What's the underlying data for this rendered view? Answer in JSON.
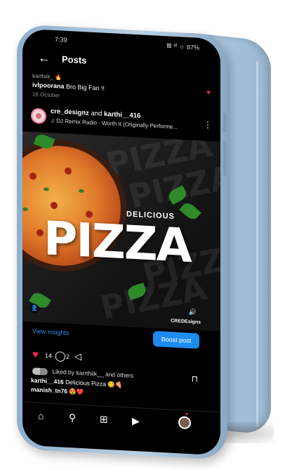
{
  "status": {
    "time": "7:39",
    "signal": "⊠ ᵃᵗ",
    "battery": "87%"
  },
  "header": {
    "title": "Posts"
  },
  "comment": {
    "prev_user": "karthiik_",
    "user": "ivlpoorana",
    "text": "Bro Big Fan !!",
    "date": "18 October"
  },
  "post": {
    "author1": "cre_designz",
    "connector": "and",
    "author2": "karthi__416",
    "music": "DJ Remix Radio · Worth It (Originally Performe...",
    "image": {
      "big_word": "PIZZA",
      "small_word": "DELICIOUS",
      "background_word": "PIZZA",
      "brand": "CREDEsigns"
    },
    "insights_label": "View insights",
    "boost_label": "Boost post",
    "like_count": "14",
    "comment_count": "2",
    "liked_by_text": "Liked by karrthiik__ and others",
    "caption_user": "karthi__416",
    "caption_text": "Delicious Pizza 😋🍕",
    "sub_user": "manish_tn76",
    "sub_text": "😍❤️"
  },
  "colors": {
    "accent_blue": "#1d8cf0",
    "link_blue": "#3d8cf0",
    "heart_red": "#ee2a4a"
  },
  "icons": {
    "back": "←",
    "heart": "♥",
    "comment": "◯",
    "share": "◁",
    "bookmark": "⊓",
    "home": "⌂",
    "search": "⚲",
    "add": "⊞",
    "reels": "▶",
    "kebab": "⋮"
  }
}
